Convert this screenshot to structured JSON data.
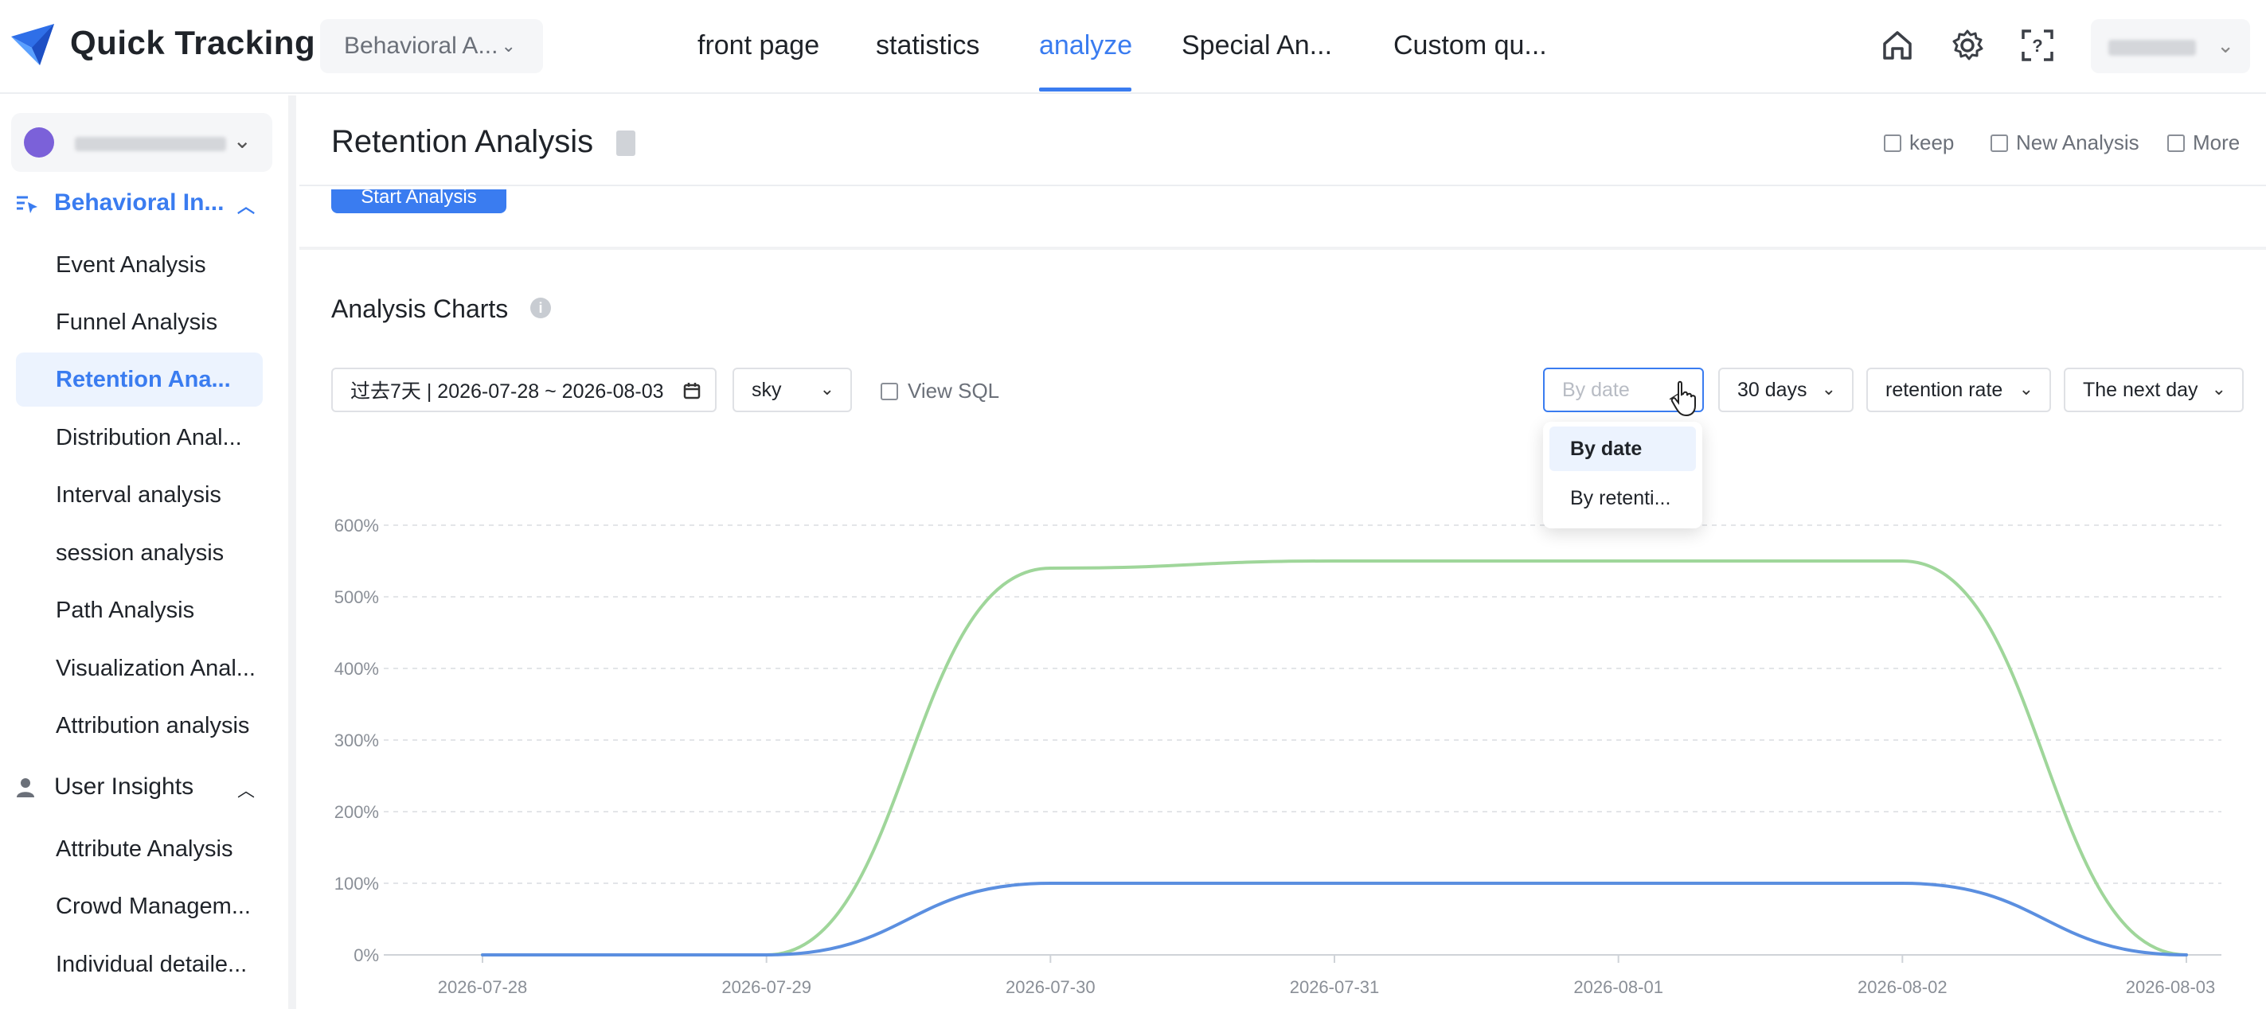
{
  "app": {
    "brand": "Quick Tracking"
  },
  "header": {
    "project_selector": "Behavioral A...",
    "nav": [
      {
        "label": "front page"
      },
      {
        "label": "statistics"
      },
      {
        "label": "analyze",
        "active": true
      },
      {
        "label": "Special An..."
      },
      {
        "label": "Custom qu..."
      }
    ],
    "icons": [
      "home-icon",
      "gear-icon",
      "help-icon"
    ]
  },
  "sidebar": {
    "groups": [
      {
        "label": "Behavioral In...",
        "icon": "behavior-icon",
        "expanded": true,
        "items": [
          {
            "label": "Event Analysis"
          },
          {
            "label": "Funnel Analysis"
          },
          {
            "label": "Retention Ana...",
            "active": true
          },
          {
            "label": "Distribution Anal..."
          },
          {
            "label": "Interval analysis"
          },
          {
            "label": "session analysis"
          },
          {
            "label": "Path Analysis"
          },
          {
            "label": "Visualization Anal..."
          },
          {
            "label": "Attribution analysis"
          }
        ]
      },
      {
        "label": "User Insights",
        "icon": "user-icon",
        "expanded": true,
        "items": [
          {
            "label": "Attribute Analysis"
          },
          {
            "label": "Crowd Managem..."
          },
          {
            "label": "Individual detaile..."
          }
        ]
      }
    ]
  },
  "page": {
    "title": "Retention Analysis",
    "actions": {
      "keep": "keep",
      "new_analysis": "New Analysis",
      "more": "More"
    },
    "start_button": "Start Analysis",
    "section_title": "Analysis Charts",
    "controls": {
      "date_range": "过去7天 | 2026-07-28 ~ 2026-08-03",
      "segment": "sky",
      "view_sql": "View SQL",
      "group_by_placeholder": "By date",
      "period": "30 days",
      "metric": "retention rate",
      "retention_day": "The next day"
    },
    "group_by_dropdown": {
      "open": true,
      "options": [
        {
          "label": "By date",
          "selected": true
        },
        {
          "label": "By retenti..."
        }
      ]
    }
  },
  "colors": {
    "accent": "#3a7cf0",
    "series_green": "#9fd69a",
    "series_blue": "#5b8fe0"
  },
  "chart_data": {
    "type": "line",
    "x": [
      "2026-07-28",
      "2026-07-29",
      "2026-07-30",
      "2026-07-31",
      "2026-08-01",
      "2026-08-02",
      "2026-08-03"
    ],
    "ylim": [
      0,
      600
    ],
    "yticks": [
      "0%",
      "100%",
      "200%",
      "300%",
      "400%",
      "500%",
      "600%"
    ],
    "grid": true,
    "series": [
      {
        "color": "#9fd69a",
        "values": [
          0,
          0,
          540,
          550,
          550,
          550,
          0
        ]
      },
      {
        "color": "#5b8fe0",
        "values": [
          0,
          0,
          100,
          100,
          100,
          100,
          0
        ]
      }
    ]
  }
}
